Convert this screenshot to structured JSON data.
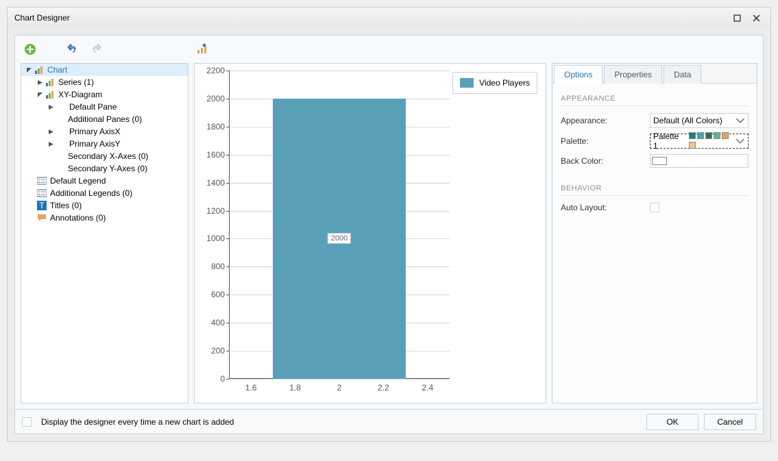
{
  "window": {
    "title": "Chart Designer"
  },
  "tree": {
    "root": "Chart",
    "items": [
      "Series (1)",
      "XY-Diagram",
      "Default Pane",
      "Additional Panes (0)",
      "Primary AxisX",
      "Primary AxisY",
      "Secondary X-Axes (0)",
      "Secondary Y-Axes (0)",
      "Default Legend",
      "Additional Legends (0)",
      "Titles (0)",
      "Annotations (0)"
    ]
  },
  "tabs": {
    "options": "Options",
    "properties": "Properties",
    "data": "Data"
  },
  "appearance": {
    "section": "APPEARANCE",
    "appearance_label": "Appearance:",
    "appearance_value": "Default (All Colors)",
    "palette_label": "Palette:",
    "palette_value": "Palette 1",
    "palette_colors": [
      "#1a7d7d",
      "#4aa6a6",
      "#2d6f5e",
      "#5fb88f",
      "#e8a35c",
      "#f2c48f"
    ],
    "backcolor_label": "Back Color:"
  },
  "behavior": {
    "section": "BEHAVIOR",
    "auto_layout_label": "Auto Layout:"
  },
  "footer": {
    "designer_checkbox": "Display the designer every time a new chart is added",
    "ok": "OK",
    "cancel": "Cancel"
  },
  "chart_data": {
    "type": "bar",
    "series": [
      {
        "name": "Video Players",
        "x": [
          2
        ],
        "values": [
          2000
        ]
      }
    ],
    "label_value": "2000",
    "yticks": [
      0,
      200,
      400,
      600,
      800,
      1000,
      1200,
      1400,
      1600,
      1800,
      2000,
      2200
    ],
    "xticks": [
      1.6,
      1.8,
      2,
      2.2,
      2.4
    ],
    "xlim": [
      1.5,
      2.5
    ],
    "ylim": [
      0,
      2200
    ],
    "bar_color": "#5a9fb8"
  }
}
